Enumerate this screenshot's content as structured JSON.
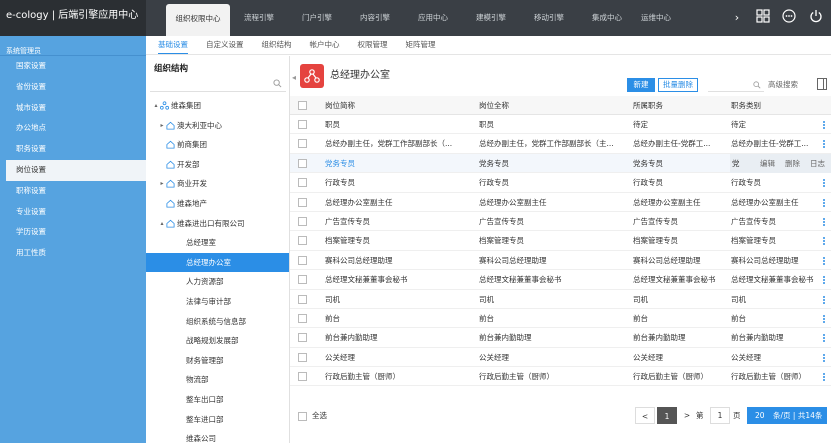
{
  "app": {
    "brand": "e-cology | 后端引擎应用中心"
  },
  "topnav": {
    "items": [
      {
        "label": "组织权限中心",
        "active": true
      },
      {
        "label": "流程引擎"
      },
      {
        "label": "门户引擎"
      },
      {
        "label": "内容引擎"
      },
      {
        "label": "应用中心"
      },
      {
        "label": "建模引擎"
      },
      {
        "label": "移动引擎"
      },
      {
        "label": "集成中心"
      },
      {
        "label": "运维中心"
      }
    ],
    "next_label": "›"
  },
  "sidebar": {
    "header": "系统管理员",
    "items": [
      {
        "label": "国家设置"
      },
      {
        "label": "省份设置"
      },
      {
        "label": "城市设置"
      },
      {
        "label": "办公地点"
      },
      {
        "label": "职务设置"
      },
      {
        "label": "岗位设置",
        "active": true
      },
      {
        "label": "职称设置"
      },
      {
        "label": "专业设置"
      },
      {
        "label": "学历设置"
      },
      {
        "label": "用工性质"
      }
    ]
  },
  "subnav": {
    "items": [
      {
        "label": "基础设置",
        "active": true
      },
      {
        "label": "自定义设置"
      },
      {
        "label": "组织结构"
      },
      {
        "label": "帐户中心"
      },
      {
        "label": "权限管理"
      },
      {
        "label": "矩阵管理"
      }
    ]
  },
  "tree": {
    "title": "组织结构",
    "nodes": [
      {
        "label": "维森集团",
        "toggle": "▴",
        "icon": "group-icon"
      },
      {
        "label": "澳大利亚中心",
        "toggle": "▸",
        "icon": "org-icon"
      },
      {
        "label": "前商集团",
        "icon": "org-icon"
      },
      {
        "label": "开发部",
        "icon": "org-icon"
      },
      {
        "label": "商业开发",
        "toggle": "▸",
        "icon": "org-icon"
      },
      {
        "label": "维森地产",
        "icon": "org-icon"
      },
      {
        "label": "维森进出口有限公司",
        "toggle": "▴",
        "icon": "org-icon"
      },
      {
        "label": "总经理室"
      },
      {
        "label": "总经理办公室",
        "active": true
      },
      {
        "label": "人力资源部"
      },
      {
        "label": "法律与审计部"
      },
      {
        "label": "组织系统与信息部"
      },
      {
        "label": "战略规划发展部"
      },
      {
        "label": "财务管理部"
      },
      {
        "label": "物流部"
      },
      {
        "label": "整车出口部"
      },
      {
        "label": "整车进口部"
      },
      {
        "label": "维森公司"
      }
    ]
  },
  "main": {
    "title": "总经理办公室",
    "new_button": "新建",
    "batch_delete_button": "批量删除",
    "search_placeholder": "",
    "advanced_search": "高级搜索",
    "table": {
      "headers": [
        "岗位简称",
        "岗位全称",
        "所属职务",
        "职务类别"
      ],
      "rows": [
        [
          "职员",
          "职员",
          "待定",
          "待定"
        ],
        [
          "总经办副主任，党群工作部副部长（...",
          "总经办副主任，党群工作部副部长（主...",
          "总经办副主任-党群工...",
          "总经办副主任-党群工..."
        ],
        [
          "党务专员",
          "党务专员",
          "党务专员",
          "党"
        ],
        [
          "行政专员",
          "行政专员",
          "行政专员",
          "行政专员"
        ],
        [
          "总经理办公室副主任",
          "总经理办公室副主任",
          "总经理办公室副主任",
          "总经理办公室副主任"
        ],
        [
          "广告宣传专员",
          "广告宣传专员",
          "广告宣传专员",
          "广告宣传专员"
        ],
        [
          "档案管理专员",
          "档案管理专员",
          "档案管理专员",
          "档案管理专员"
        ],
        [
          "赛科公司总经理助理",
          "赛科公司总经理助理",
          "赛科公司总经理助理",
          "赛科公司总经理助理"
        ],
        [
          "总经理文秘兼董事会秘书",
          "总经理文秘兼董事会秘书",
          "总经理文秘兼董事会秘书",
          "总经理文秘兼董事会秘书"
        ],
        [
          "司机",
          "司机",
          "司机",
          "司机"
        ],
        [
          "前台",
          "前台",
          "前台",
          "前台"
        ],
        [
          "前台兼内勤助理",
          "前台兼内勤助理",
          "前台兼内勤助理",
          "前台兼内勤助理"
        ],
        [
          "公关经理",
          "公关经理",
          "公关经理",
          "公关经理"
        ],
        [
          "行政后勤主管（厨师）",
          "行政后勤主管（厨师）",
          "行政后勤主管（厨师）",
          "行政后勤主管（厨师）"
        ]
      ],
      "hover_row_index": 2,
      "row_actions": [
        "编辑",
        "删除",
        "日志"
      ]
    },
    "footer": {
      "select_all": "全选",
      "prev": "<",
      "current_page": "1",
      "next": ">",
      "goto_label": "第",
      "goto_value": "1",
      "page_label": "页",
      "page_size": "20",
      "page_size_text": "条/页 | 共14条"
    }
  },
  "colors": {
    "accent": "#2b8ee6",
    "sidebar": "#56a3e0",
    "topbar": "#3a3f45",
    "logo": "#e5433f"
  }
}
